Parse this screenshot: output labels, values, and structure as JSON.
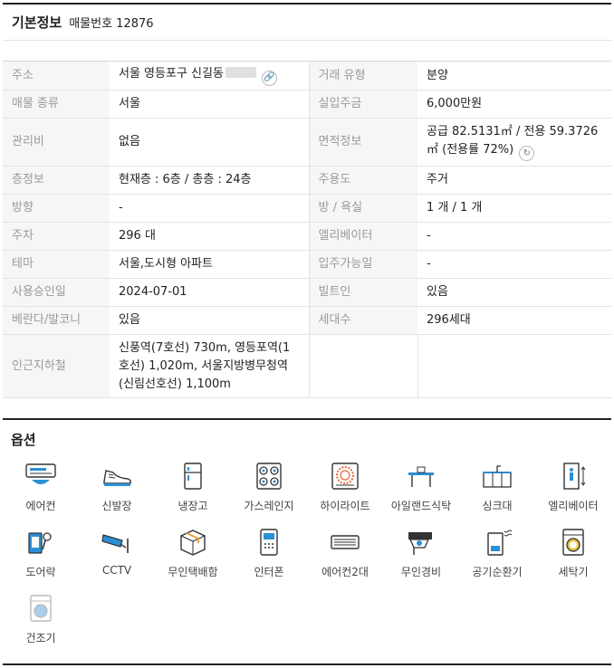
{
  "header": {
    "title": "기본정보",
    "listing_label": "매물번호 12876"
  },
  "info": {
    "rows": [
      {
        "k1": "주소",
        "v1": "서울 영등포구 신길동",
        "k2": "거래 유형",
        "v2": "분양"
      },
      {
        "k1": "매물 종류",
        "v1": "서울",
        "k2": "실입주금",
        "v2": "6,000만원"
      },
      {
        "k1": "관리비",
        "v1": "없음",
        "k2": "면적정보",
        "v2": "공급 82.5131㎡ / 전용 59.3726㎡ (전용률 72%)"
      },
      {
        "k1": "층정보",
        "v1": "현재층 : 6층 / 총층 : 24층",
        "k2": "주용도",
        "v2": "주거"
      },
      {
        "k1": "방향",
        "v1": "-",
        "k2": "방 / 욕실",
        "v2": "1 개 / 1 개"
      },
      {
        "k1": "주차",
        "v1": "296 대",
        "k2": "엘리베이터",
        "v2": "-"
      },
      {
        "k1": "테마",
        "v1": "서울,도시형 아파트",
        "k2": "입주가능일",
        "v2": "-"
      },
      {
        "k1": "사용승인일",
        "v1": "2024-07-01",
        "k2": "빌트인",
        "v2": "있음"
      },
      {
        "k1": "베란다/발코니",
        "v1": "있음",
        "k2": "세대수",
        "v2": "296세대"
      },
      {
        "k1": "인근지하철",
        "v1": "신풍역(7호선) 730m, 영등포역(1호선) 1,020m, 서울지방병무청역(신림선호선) 1,100m",
        "k2": "",
        "v2": ""
      }
    ]
  },
  "options": {
    "title": "옵션",
    "items": [
      {
        "label": "에어컨",
        "icon": "air-conditioner-icon"
      },
      {
        "label": "신발장",
        "icon": "shoe-rack-icon"
      },
      {
        "label": "냉장고",
        "icon": "refrigerator-icon"
      },
      {
        "label": "가스레인지",
        "icon": "gas-range-icon"
      },
      {
        "label": "하이라이트",
        "icon": "highlight-cooktop-icon"
      },
      {
        "label": "아일랜드식탁",
        "icon": "island-table-icon"
      },
      {
        "label": "싱크대",
        "icon": "sink-icon"
      },
      {
        "label": "엘리베이터",
        "icon": "elevator-icon"
      },
      {
        "label": "도어락",
        "icon": "door-lock-icon"
      },
      {
        "label": "CCTV",
        "icon": "cctv-icon"
      },
      {
        "label": "무인택배함",
        "icon": "parcel-box-icon"
      },
      {
        "label": "인터폰",
        "icon": "interphone-icon"
      },
      {
        "label": "에어컨2대",
        "icon": "air-conditioner-2-icon"
      },
      {
        "label": "무인경비",
        "icon": "security-camera-icon"
      },
      {
        "label": "공기순환기",
        "icon": "air-circulator-icon"
      },
      {
        "label": "세탁기",
        "icon": "washing-machine-icon"
      },
      {
        "label": "건조기",
        "icon": "dryer-icon"
      }
    ]
  },
  "colors": {
    "accent": "#2b8fd6",
    "line": "#222222",
    "label": "#9a9a9a",
    "label_bg": "#f6f6f6"
  }
}
